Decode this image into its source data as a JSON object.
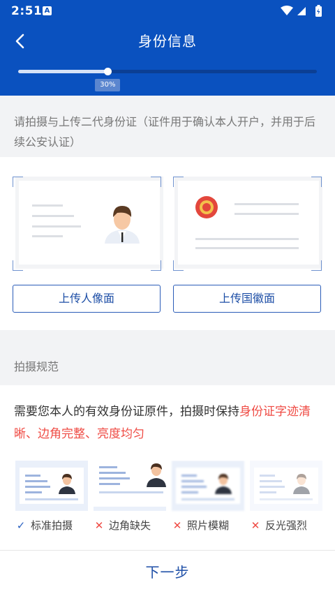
{
  "status_bar": {
    "time": "2:51",
    "a_icon": "A"
  },
  "header": {
    "title": "身份信息",
    "progress_value": 0.3,
    "progress_label": "30%"
  },
  "instruction": "请拍摄与上传二代身份证（证件用于确认本人开户，并用于后续公安认证）",
  "upload": {
    "portrait_label": "上传人像面",
    "emblem_label": "上传国徽面"
  },
  "rules": {
    "section_title": "拍摄规范",
    "requirement_prefix": "需要您本人的有效身份证原件，拍摄时保持",
    "requirement_emphasis": "身份证字迹清晰、边角完整、亮度均匀",
    "examples": [
      {
        "label": "标准拍摄",
        "mark": "✓",
        "ok": true
      },
      {
        "label": "边角缺失",
        "mark": "✕",
        "ok": false
      },
      {
        "label": "照片模糊",
        "mark": "✕",
        "ok": false
      },
      {
        "label": "反光强烈",
        "mark": "✕",
        "ok": false
      }
    ]
  },
  "footer": {
    "next_label": "下一步"
  },
  "colors": {
    "primary": "#0a51bf",
    "accent_red": "#ef4b44",
    "button_text": "#1d4ea6"
  }
}
